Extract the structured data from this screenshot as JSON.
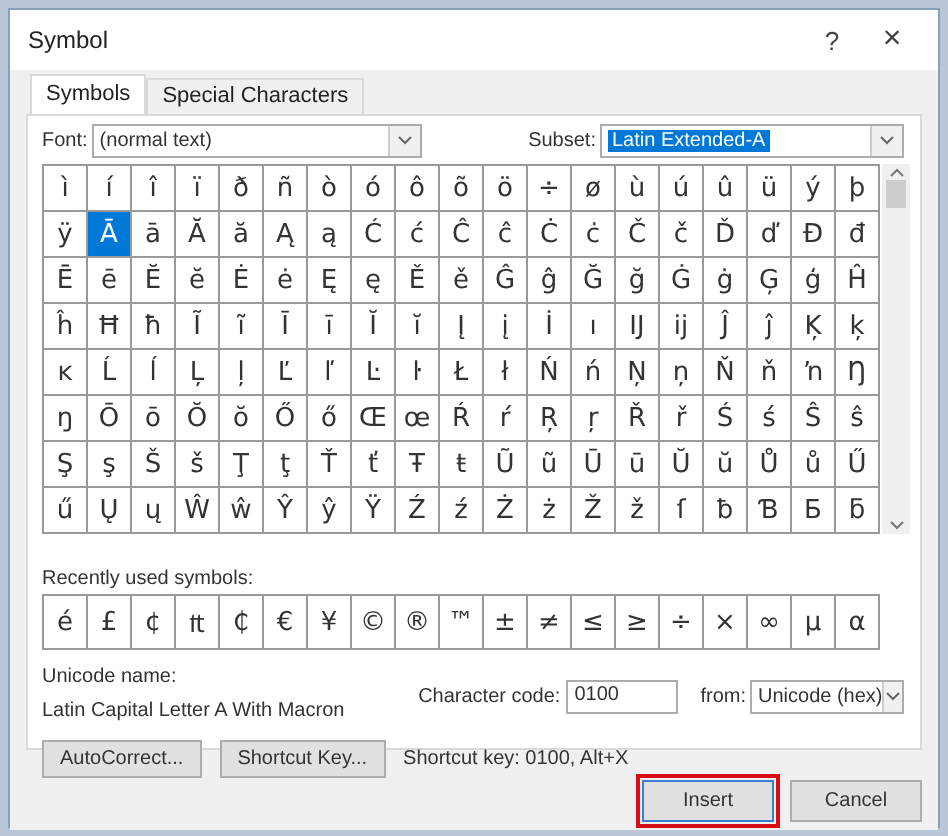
{
  "window": {
    "title": "Symbol",
    "help": "?",
    "close": "×"
  },
  "tabs": [
    {
      "label": "Symbols",
      "selected": true
    },
    {
      "label": "Special Characters",
      "selected": false
    }
  ],
  "font": {
    "label": "Font:",
    "value": "(normal text)"
  },
  "subset": {
    "label": "Subset:",
    "value": "Latin Extended-A"
  },
  "grid": {
    "rows": [
      {
        "cells": [
          {
            "char": "ì",
            "selected": false
          },
          {
            "char": "í",
            "selected": false
          },
          {
            "char": "î",
            "selected": false
          },
          {
            "char": "ï",
            "selected": false
          },
          {
            "char": "ð",
            "selected": false
          },
          {
            "char": "ñ",
            "selected": false
          },
          {
            "char": "ò",
            "selected": false
          },
          {
            "char": "ó",
            "selected": false
          },
          {
            "char": "ô",
            "selected": false
          },
          {
            "char": "õ",
            "selected": false
          },
          {
            "char": "ö",
            "selected": false
          },
          {
            "char": "÷",
            "selected": false
          },
          {
            "char": "ø",
            "selected": false
          },
          {
            "char": "ù",
            "selected": false
          },
          {
            "char": "ú",
            "selected": false
          },
          {
            "char": "û",
            "selected": false
          },
          {
            "char": "ü",
            "selected": false
          },
          {
            "char": "ý",
            "selected": false
          },
          {
            "char": "þ",
            "selected": false
          }
        ]
      },
      {
        "cells": [
          {
            "char": "ÿ",
            "selected": false
          },
          {
            "char": "Ā",
            "selected": true
          },
          {
            "char": "ā",
            "selected": false
          },
          {
            "char": "Ă",
            "selected": false
          },
          {
            "char": "ă",
            "selected": false
          },
          {
            "char": "Ą",
            "selected": false
          },
          {
            "char": "ą",
            "selected": false
          },
          {
            "char": "Ć",
            "selected": false
          },
          {
            "char": "ć",
            "selected": false
          },
          {
            "char": "Ĉ",
            "selected": false
          },
          {
            "char": "ĉ",
            "selected": false
          },
          {
            "char": "Ċ",
            "selected": false
          },
          {
            "char": "ċ",
            "selected": false
          },
          {
            "char": "Č",
            "selected": false
          },
          {
            "char": "č",
            "selected": false
          },
          {
            "char": "Ď",
            "selected": false
          },
          {
            "char": "ď",
            "selected": false
          },
          {
            "char": "Đ",
            "selected": false
          },
          {
            "char": "đ",
            "selected": false
          }
        ]
      },
      {
        "cells": [
          {
            "char": "Ē",
            "selected": false
          },
          {
            "char": "ē",
            "selected": false
          },
          {
            "char": "Ĕ",
            "selected": false
          },
          {
            "char": "ĕ",
            "selected": false
          },
          {
            "char": "Ė",
            "selected": false
          },
          {
            "char": "ė",
            "selected": false
          },
          {
            "char": "Ę",
            "selected": false
          },
          {
            "char": "ę",
            "selected": false
          },
          {
            "char": "Ě",
            "selected": false
          },
          {
            "char": "ě",
            "selected": false
          },
          {
            "char": "Ĝ",
            "selected": false
          },
          {
            "char": "ĝ",
            "selected": false
          },
          {
            "char": "Ğ",
            "selected": false
          },
          {
            "char": "ğ",
            "selected": false
          },
          {
            "char": "Ġ",
            "selected": false
          },
          {
            "char": "ġ",
            "selected": false
          },
          {
            "char": "Ģ",
            "selected": false
          },
          {
            "char": "ģ",
            "selected": false
          },
          {
            "char": "Ĥ",
            "selected": false
          }
        ]
      },
      {
        "cells": [
          {
            "char": "ĥ",
            "selected": false
          },
          {
            "char": "Ħ",
            "selected": false
          },
          {
            "char": "ħ",
            "selected": false
          },
          {
            "char": "Ĩ",
            "selected": false
          },
          {
            "char": "ĩ",
            "selected": false
          },
          {
            "char": "Ī",
            "selected": false
          },
          {
            "char": "ī",
            "selected": false
          },
          {
            "char": "Ĭ",
            "selected": false
          },
          {
            "char": "ĭ",
            "selected": false
          },
          {
            "char": "Į",
            "selected": false
          },
          {
            "char": "į",
            "selected": false
          },
          {
            "char": "İ",
            "selected": false
          },
          {
            "char": "ı",
            "selected": false
          },
          {
            "char": "Ĳ",
            "selected": false
          },
          {
            "char": "ĳ",
            "selected": false
          },
          {
            "char": "Ĵ",
            "selected": false
          },
          {
            "char": "ĵ",
            "selected": false
          },
          {
            "char": "Ķ",
            "selected": false
          },
          {
            "char": "ķ",
            "selected": false
          }
        ]
      },
      {
        "cells": [
          {
            "char": "ĸ",
            "selected": false
          },
          {
            "char": "Ĺ",
            "selected": false
          },
          {
            "char": "ĺ",
            "selected": false
          },
          {
            "char": "Ļ",
            "selected": false
          },
          {
            "char": "ļ",
            "selected": false
          },
          {
            "char": "Ľ",
            "selected": false
          },
          {
            "char": "ľ",
            "selected": false
          },
          {
            "char": "Ŀ",
            "selected": false
          },
          {
            "char": "ŀ",
            "selected": false
          },
          {
            "char": "Ł",
            "selected": false
          },
          {
            "char": "ł",
            "selected": false
          },
          {
            "char": "Ń",
            "selected": false
          },
          {
            "char": "ń",
            "selected": false
          },
          {
            "char": "Ņ",
            "selected": false
          },
          {
            "char": "ņ",
            "selected": false
          },
          {
            "char": "Ň",
            "selected": false
          },
          {
            "char": "ň",
            "selected": false
          },
          {
            "char": "ŉ",
            "selected": false
          },
          {
            "char": "Ŋ",
            "selected": false
          }
        ]
      },
      {
        "cells": [
          {
            "char": "ŋ",
            "selected": false
          },
          {
            "char": "Ō",
            "selected": false
          },
          {
            "char": "ō",
            "selected": false
          },
          {
            "char": "Ŏ",
            "selected": false
          },
          {
            "char": "ŏ",
            "selected": false
          },
          {
            "char": "Ő",
            "selected": false
          },
          {
            "char": "ő",
            "selected": false
          },
          {
            "char": "Œ",
            "selected": false
          },
          {
            "char": "œ",
            "selected": false
          },
          {
            "char": "Ŕ",
            "selected": false
          },
          {
            "char": "ŕ",
            "selected": false
          },
          {
            "char": "Ŗ",
            "selected": false
          },
          {
            "char": "ŗ",
            "selected": false
          },
          {
            "char": "Ř",
            "selected": false
          },
          {
            "char": "ř",
            "selected": false
          },
          {
            "char": "Ś",
            "selected": false
          },
          {
            "char": "ś",
            "selected": false
          },
          {
            "char": "Ŝ",
            "selected": false
          },
          {
            "char": "ŝ",
            "selected": false
          }
        ]
      },
      {
        "cells": [
          {
            "char": "Ş",
            "selected": false
          },
          {
            "char": "ş",
            "selected": false
          },
          {
            "char": "Š",
            "selected": false
          },
          {
            "char": "š",
            "selected": false
          },
          {
            "char": "Ţ",
            "selected": false
          },
          {
            "char": "ţ",
            "selected": false
          },
          {
            "char": "Ť",
            "selected": false
          },
          {
            "char": "ť",
            "selected": false
          },
          {
            "char": "Ŧ",
            "selected": false
          },
          {
            "char": "ŧ",
            "selected": false
          },
          {
            "char": "Ũ",
            "selected": false
          },
          {
            "char": "ũ",
            "selected": false
          },
          {
            "char": "Ū",
            "selected": false
          },
          {
            "char": "ū",
            "selected": false
          },
          {
            "char": "Ŭ",
            "selected": false
          },
          {
            "char": "ŭ",
            "selected": false
          },
          {
            "char": "Ů",
            "selected": false
          },
          {
            "char": "ů",
            "selected": false
          },
          {
            "char": "Ű",
            "selected": false
          }
        ]
      },
      {
        "cells": [
          {
            "char": "ű",
            "selected": false
          },
          {
            "char": "Ų",
            "selected": false
          },
          {
            "char": "ų",
            "selected": false
          },
          {
            "char": "Ŵ",
            "selected": false
          },
          {
            "char": "ŵ",
            "selected": false
          },
          {
            "char": "Ŷ",
            "selected": false
          },
          {
            "char": "ŷ",
            "selected": false
          },
          {
            "char": "Ÿ",
            "selected": false
          },
          {
            "char": "Ź",
            "selected": false
          },
          {
            "char": "ź",
            "selected": false
          },
          {
            "char": "Ż",
            "selected": false
          },
          {
            "char": "ż",
            "selected": false
          },
          {
            "char": "Ž",
            "selected": false
          },
          {
            "char": "ž",
            "selected": false
          },
          {
            "char": "ſ",
            "selected": false
          },
          {
            "char": "ƀ",
            "selected": false
          },
          {
            "char": "Ɓ",
            "selected": false
          },
          {
            "char": "Ƃ",
            "selected": false
          },
          {
            "char": "ƃ",
            "selected": false
          }
        ]
      }
    ]
  },
  "recent": {
    "label": "Recently used symbols:",
    "symbols": [
      "é",
      "£",
      "¢",
      "₶",
      "₵",
      "€",
      "¥",
      "©",
      "®",
      "™",
      "±",
      "≠",
      "≤",
      "≥",
      "÷",
      "×",
      "∞",
      "µ",
      "α"
    ]
  },
  "unicode_name": {
    "label": "Unicode name:",
    "value": "Latin Capital Letter A With Macron"
  },
  "character_code": {
    "label": "Character code:",
    "value": "0100"
  },
  "from": {
    "label": "from:",
    "value": "Unicode (hex)"
  },
  "buttons": [
    "AutoCorrect...",
    "Shortcut Key..."
  ],
  "shortcut_text": "Shortcut key: 0100, Alt+X",
  "footer_buttons": [
    {
      "label": "Insert",
      "focused": true
    },
    {
      "label": "Cancel",
      "focused": false
    }
  ]
}
